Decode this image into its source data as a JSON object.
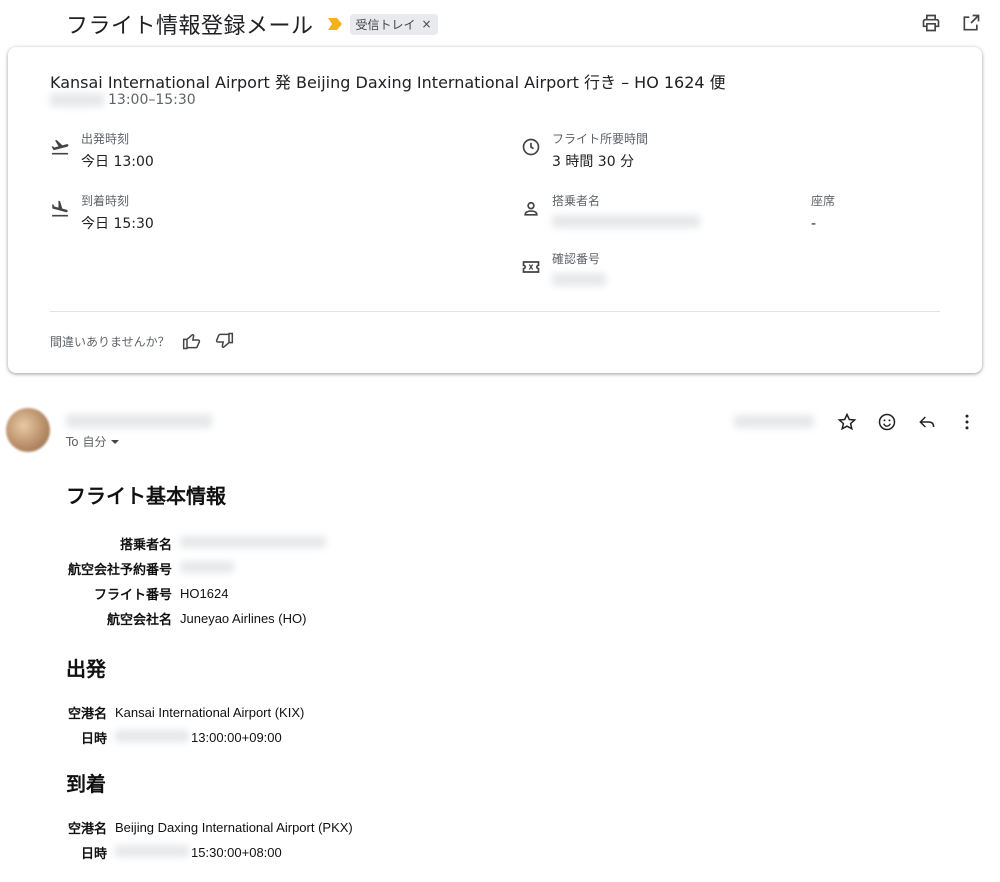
{
  "header": {
    "subject": "フライト情報登録メール",
    "label": "受信トレイ",
    "label_close": "×",
    "actions": [
      "print-icon",
      "open-in-new-window-icon"
    ],
    "importance_color": "#f2b21b"
  },
  "summary_card": {
    "title": "Kansai International Airport 発 Beijing Daxing International Airport 行き – HO 1624 便",
    "time_range": "13:00–15:30",
    "departure_label": "出発時刻",
    "departure_value": "今日 13:00",
    "arrival_label": "到着時刻",
    "arrival_value": "今日 15:30",
    "duration_label": "フライト所要時間",
    "duration_value": "3 時間 30 分",
    "passenger_label": "搭乗者名",
    "seat_label": "座席",
    "seat_value": "-",
    "confirmation_label": "確認番号",
    "feedback_prompt": "間違いありませんか？"
  },
  "message": {
    "to_label": "To 自分",
    "row_actions": [
      "star-icon",
      "emoji-icon",
      "reply-icon",
      "more-vert-icon"
    ]
  },
  "body": {
    "basic_heading": "フライト基本情報",
    "basic": {
      "passenger_key": "搭乗者名",
      "booking_key": "航空会社予約番号",
      "flight_key": "フライト番号",
      "flight_value": "HO1624",
      "airline_key": "航空会社名",
      "airline_value": "Juneyao Airlines (HO)"
    },
    "departure_heading": "出発",
    "departure": {
      "airport_key": "空港名",
      "airport_value": "Kansai International Airport (KIX)",
      "datetime_key": "日時",
      "time_value": "13:00:00+09:00"
    },
    "arrival_heading": "到着",
    "arrival": {
      "airport_key": "空港名",
      "airport_value": "Beijing Daxing International Airport (PKX)",
      "datetime_key": "日時",
      "time_value": "15:30:00+08:00"
    }
  }
}
